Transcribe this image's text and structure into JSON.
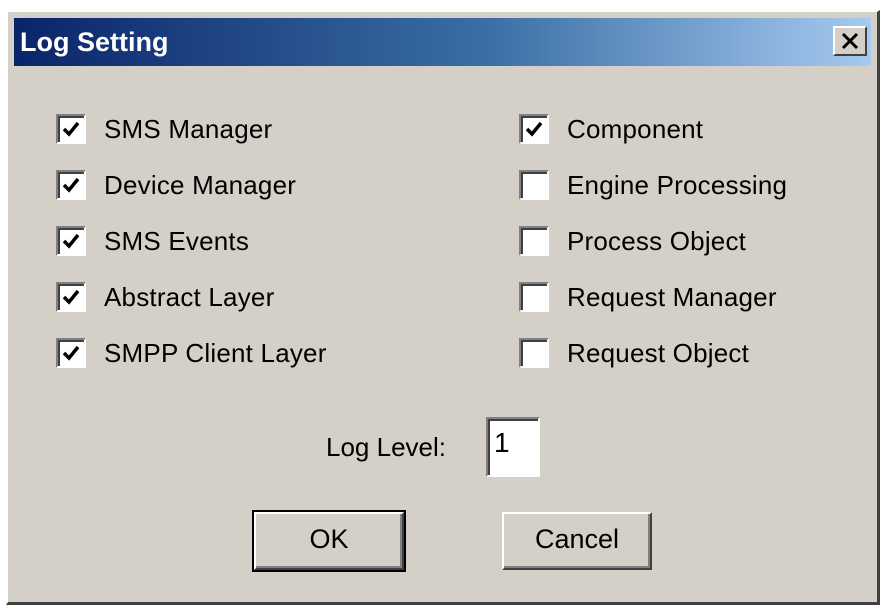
{
  "window": {
    "title": "Log Setting",
    "close_symbol": "✕"
  },
  "left_checkboxes": [
    {
      "label": "SMS Manager",
      "checked": true
    },
    {
      "label": "Device Manager",
      "checked": true
    },
    {
      "label": "SMS Events",
      "checked": true
    },
    {
      "label": "Abstract Layer",
      "checked": true
    },
    {
      "label": "SMPP Client Layer",
      "checked": true
    }
  ],
  "right_checkboxes": [
    {
      "label": "Component",
      "checked": true
    },
    {
      "label": "Engine Processing",
      "checked": false
    },
    {
      "label": "Process Object",
      "checked": false
    },
    {
      "label": "Request Manager",
      "checked": false
    },
    {
      "label": "Request Object",
      "checked": false
    }
  ],
  "log_level": {
    "label": "Log Level:",
    "value": "1"
  },
  "buttons": {
    "ok_label": "OK",
    "cancel_label": "Cancel"
  },
  "colors": {
    "title_gradient_start": "#0a246a",
    "title_gradient_end": "#a6caf0",
    "dialog_face": "#d4d0c8"
  },
  "icons": {
    "close": "close-icon",
    "check": "checkmark-icon"
  }
}
